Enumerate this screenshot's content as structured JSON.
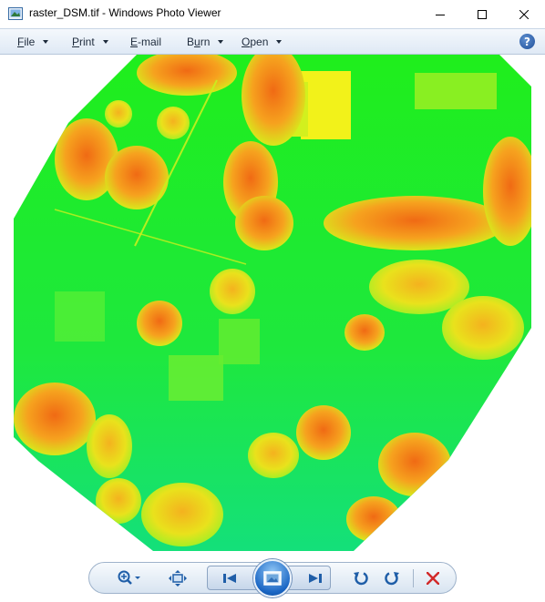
{
  "window": {
    "title": "raster_DSM.tif - Windows Photo Viewer"
  },
  "menu": {
    "items": [
      {
        "label": "File",
        "mnemonic": "F",
        "rest": "ile"
      },
      {
        "label": "Print",
        "mnemonic": "P",
        "rest": "rint"
      },
      {
        "label": "E-mail",
        "mnemonic": "E",
        "rest": "-mail"
      },
      {
        "label": "Burn",
        "mnemonic": "u",
        "pre": "B",
        "rest": "rn"
      },
      {
        "label": "Open",
        "mnemonic": "O",
        "rest": "pen"
      }
    ],
    "help_glyph": "?"
  },
  "image": {
    "filename": "raster_DSM.tif",
    "colors": {
      "low": "#22e03a",
      "mid": "#c8f21c",
      "high": "#f28a1a",
      "top": "#f25a12"
    }
  },
  "controls": {
    "icons": [
      "zoom-icon",
      "actual-size-icon",
      "previous-icon",
      "slideshow-icon",
      "next-icon",
      "rotate-counterclockwise-icon",
      "rotate-clockwise-icon",
      "delete-icon"
    ]
  }
}
